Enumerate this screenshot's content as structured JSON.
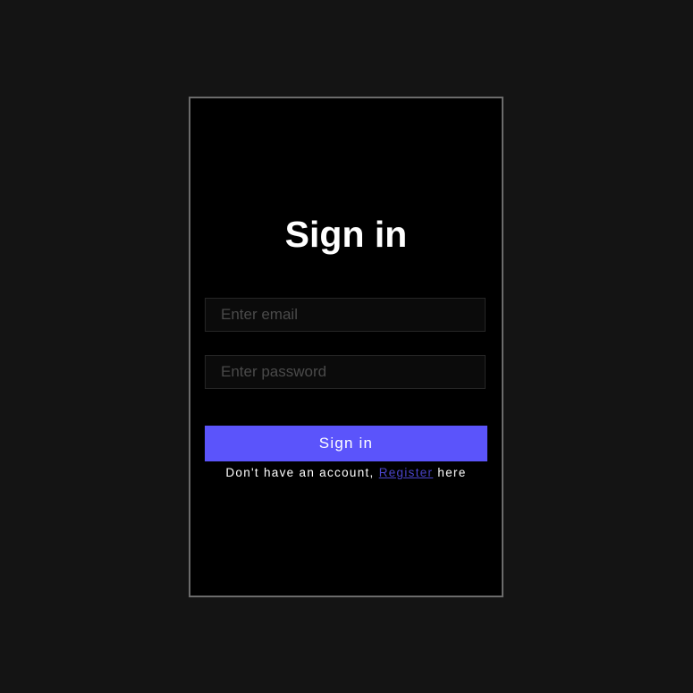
{
  "title": "Sign in",
  "email": {
    "placeholder": "Enter email"
  },
  "password": {
    "placeholder": "Enter password"
  },
  "submit_label": "Sign in",
  "footer": {
    "prefix": "Don't have an account,",
    "link": "Register",
    "suffix": "here"
  },
  "colors": {
    "accent": "#5b54fb",
    "link": "#4a44c9",
    "background": "#141414",
    "card": "#000000"
  }
}
